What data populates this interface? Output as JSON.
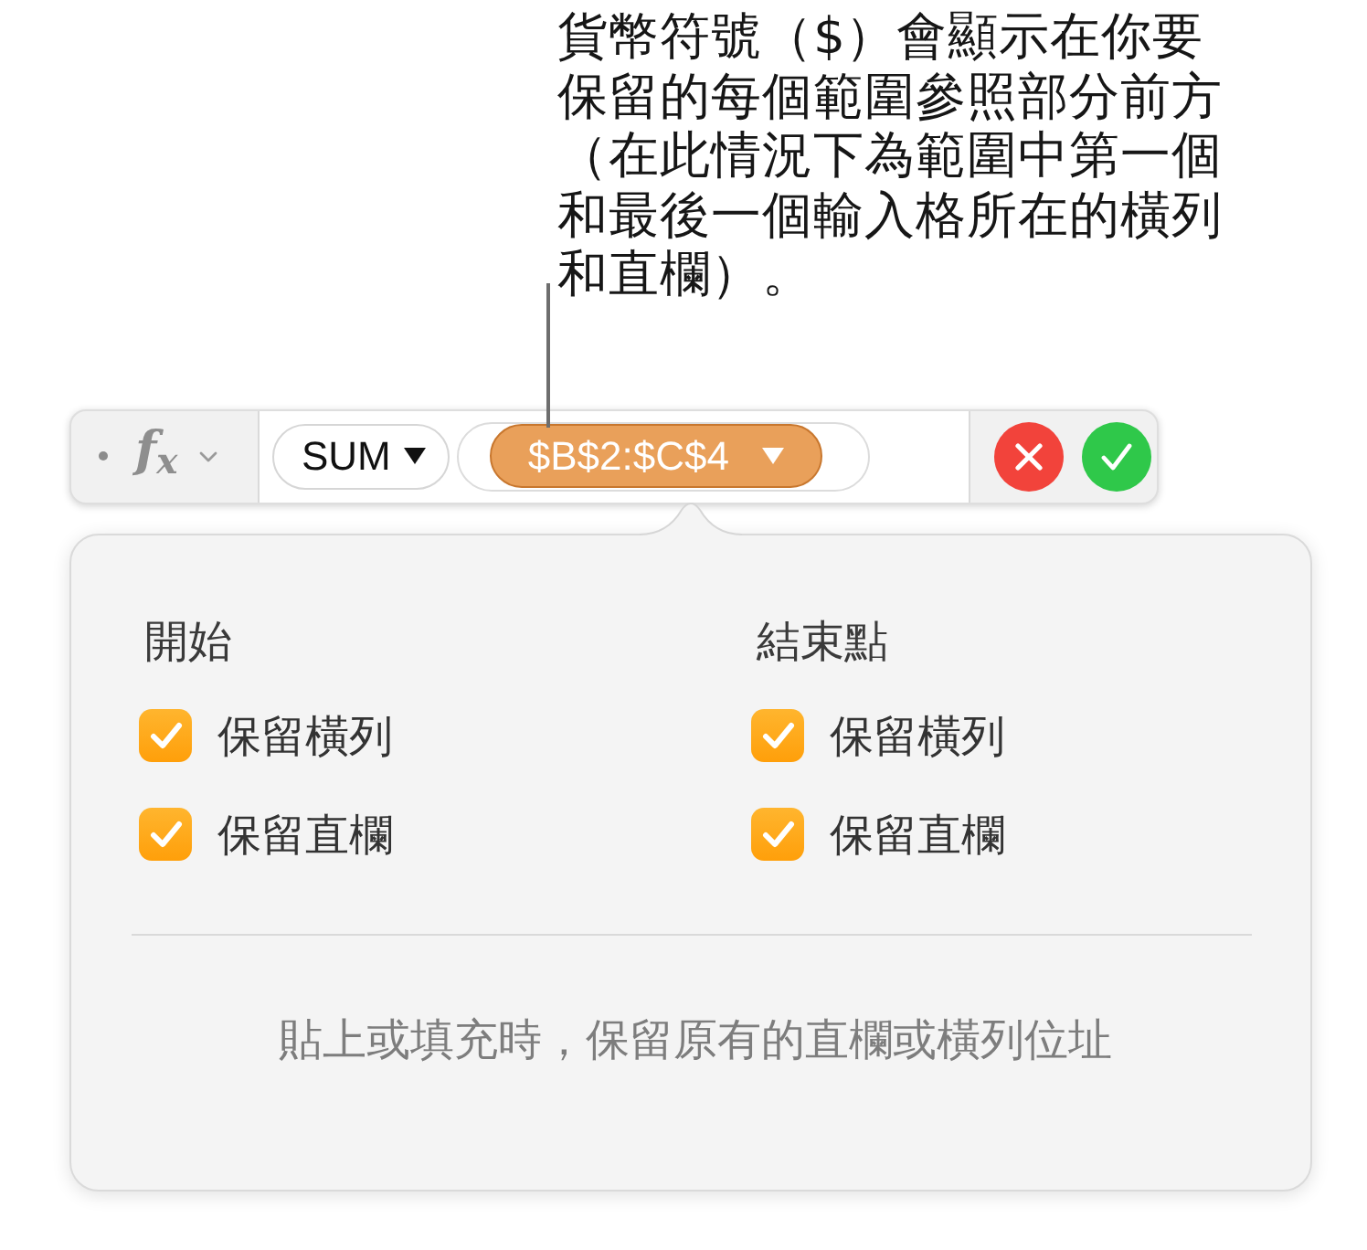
{
  "callout": {
    "text": "貨幣符號（$）會顯示在你要保留的每個範圍參照部分前方（在此情況下為範圍中第一個和最後一個輸入格所在的橫列和直欄）。"
  },
  "formula_bar": {
    "function_label": "f$_{x}$",
    "tokens": [
      {
        "kind": "function",
        "text": "SUM",
        "selected": false
      },
      {
        "kind": "range",
        "text": "$B$2:$C$4",
        "selected": true
      }
    ]
  },
  "popover": {
    "columns": [
      {
        "title": "開始",
        "options": [
          {
            "label": "保留橫列",
            "checked": true
          },
          {
            "label": "保留直欄",
            "checked": true
          }
        ]
      },
      {
        "title": "結束點",
        "options": [
          {
            "label": "保留橫列",
            "checked": true
          },
          {
            "label": "保留直欄",
            "checked": true
          }
        ]
      }
    ],
    "note": "貼上或填充時，保留原有的直欄或橫列位址"
  }
}
